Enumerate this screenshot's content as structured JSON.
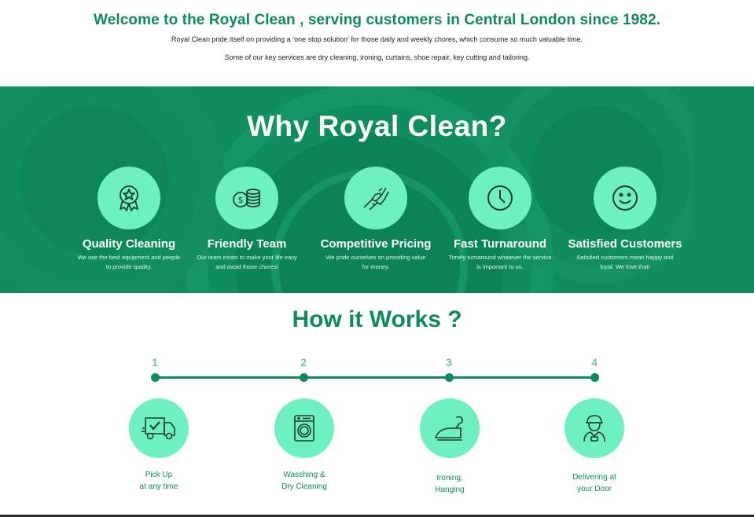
{
  "welcome": {
    "title": "Welcome to the Royal Clean , serving customers in Central London since 1982.",
    "line1": "Royal Clean pride itself on providing a ‘one stop solution’ for those daily and weekly chores, which consume so much valuable time.",
    "line2": "Some of our key services are dry cleaning, ironing, curtains, shoe repair, key cutting and tailoring."
  },
  "why": {
    "heading": "Why Royal Clean?",
    "features": [
      {
        "icon": "award-icon",
        "title": "Quality Cleaning",
        "desc": "We use the best equipment and people to provide quality."
      },
      {
        "icon": "coins-icon",
        "title": "Friendly Team",
        "desc": "Our team exists to make your life easy and avoid those chores!"
      },
      {
        "icon": "handshake-icon",
        "title": "Competitive Pricing",
        "desc": "We pride ourselves on providing value for money."
      },
      {
        "icon": "clock-icon",
        "title": "Fast Turnaround",
        "desc": "Timely turnaround whatever the service is important to us."
      },
      {
        "icon": "smiley-icon",
        "title": "Satisfied Customers",
        "desc": "Satisfied customers mean happy and loyal. We love that!"
      }
    ]
  },
  "how": {
    "heading": "How it Works ?",
    "steps": [
      {
        "num": "1",
        "icon": "delivery-truck-icon",
        "line1": "Pick Up",
        "line2": "at any time"
      },
      {
        "num": "2",
        "icon": "washing-machine-icon",
        "line1": "Wasshing &",
        "line2": "Dry Cleaning"
      },
      {
        "num": "3",
        "icon": "iron-icon",
        "line1": "Ironing,",
        "line2": "Hanging"
      },
      {
        "num": "4",
        "icon": "delivery-person-icon",
        "line1": "Delivering at",
        "line2": "your Door"
      }
    ]
  },
  "colors": {
    "brand_green": "#0e8a5c",
    "mint": "#6ff0c1",
    "banner_green": "#0f8a5e"
  }
}
